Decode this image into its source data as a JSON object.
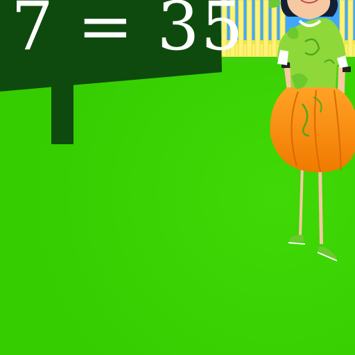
{
  "board": {
    "equation": "7 = 35"
  },
  "colors": {
    "grass": "#39d100",
    "board": "#0e4a0d",
    "fence": "#fbf26a",
    "sky": "#3fa7ff",
    "pumpkin": "#ff9010",
    "shirt": "#8fd83a",
    "skin": "#f6c9a3"
  },
  "icons": [
    "chalkboard",
    "fence",
    "pumpkin-costume-girl"
  ]
}
